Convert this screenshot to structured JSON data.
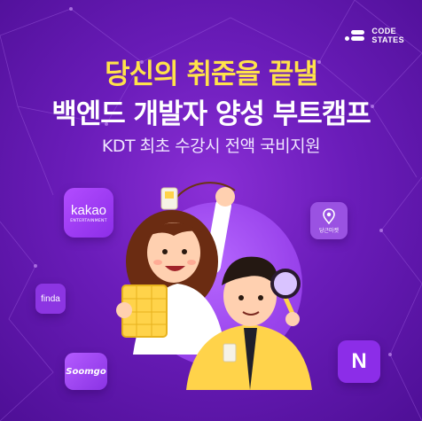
{
  "brand": {
    "logo_line1": "CODE",
    "logo_line2": "STATES"
  },
  "headline": {
    "line1": "당신의 취준을 끝낼",
    "line2": "백엔드 개발자 양성 부트캠프"
  },
  "subheadline": "KDT 최초 수강시 전액 국비지원",
  "partners": {
    "kakao": {
      "line1": "kakao",
      "line2": "ENTERTAINMENT"
    },
    "finda": "finda",
    "soomgo": "Soomgo",
    "danggeun": "당근마켓",
    "naver": "N"
  },
  "colors": {
    "background": "#6a1cb9",
    "headline_accent": "#ffe24a",
    "circle": "#9a44ec"
  }
}
